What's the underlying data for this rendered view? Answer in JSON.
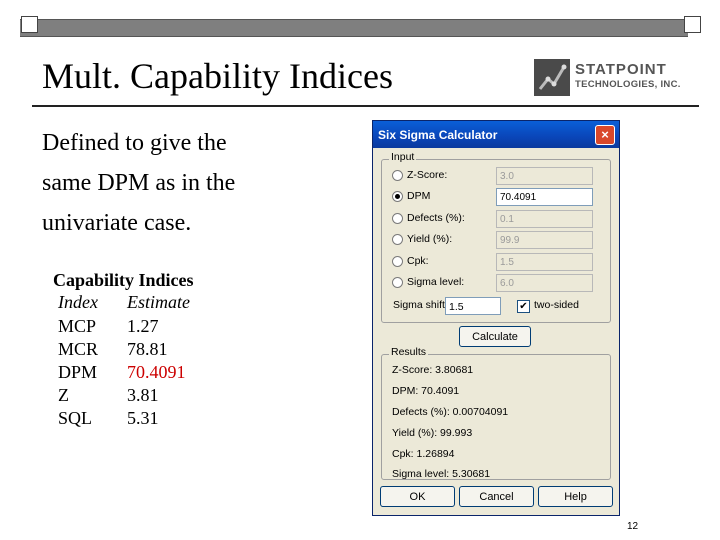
{
  "slide": {
    "title": "Mult. Capability Indices",
    "body_lines": [
      "Defined to give the",
      "same DPM as in the",
      "univariate case."
    ],
    "page_number": "12"
  },
  "logo": {
    "line1": "STATPOINT",
    "line2": "TECHNOLOGIES, INC."
  },
  "capability": {
    "title": "Capability Indices",
    "headers": [
      "Index",
      "Estimate"
    ],
    "rows": [
      {
        "index": "MCP",
        "estimate": "1.27"
      },
      {
        "index": "MCR",
        "estimate": "78.81"
      },
      {
        "index": "DPM",
        "estimate": "70.4091"
      },
      {
        "index": "Z",
        "estimate": "3.81"
      },
      {
        "index": "SQL",
        "estimate": "5.31"
      }
    ]
  },
  "dialog": {
    "title": "Six Sigma Calculator",
    "close_label": "×",
    "input_group_label": "Input",
    "options": [
      {
        "label": "Z-Score:",
        "value": "3.0",
        "selected": false
      },
      {
        "label": "DPM",
        "value": "70.4091",
        "selected": true
      },
      {
        "label": "Defects (%):",
        "value": "0.1",
        "selected": false
      },
      {
        "label": "Yield (%):",
        "value": "99.9",
        "selected": false
      },
      {
        "label": "Cpk:",
        "value": "1.5",
        "selected": false
      },
      {
        "label": "Sigma level:",
        "value": "6.0",
        "selected": false
      }
    ],
    "sigma_shift_label": "Sigma shift:",
    "sigma_shift_value": "1.5",
    "two_sided_label": "two-sided",
    "two_sided_checked": "✔",
    "calculate_label": "Calculate",
    "results_group_label": "Results",
    "results": [
      "Z-Score: 3.80681",
      "DPM: 70.4091",
      "Defects (%): 0.00704091",
      "Yield (%): 99.993",
      "Cpk: 1.26894",
      "Sigma level: 5.30681"
    ],
    "ok_label": "OK",
    "cancel_label": "Cancel",
    "help_label": "Help"
  }
}
